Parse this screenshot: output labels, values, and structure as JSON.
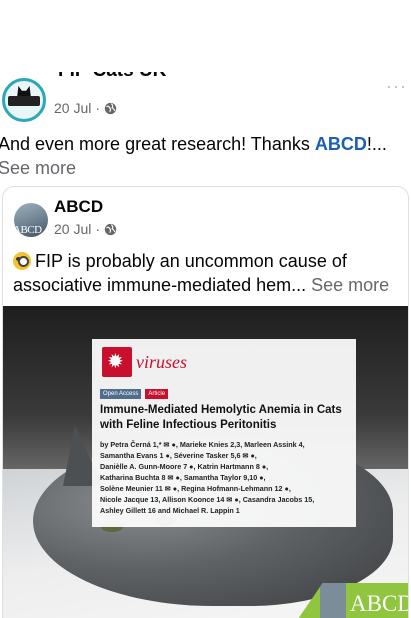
{
  "outer_post": {
    "page_name": "FIP Cats UK",
    "date": "20 Jul",
    "more": "···",
    "text_before": "And even more great research! Thanks ",
    "text_tag": "ABCD",
    "text_after": "!...",
    "see_more": "See more"
  },
  "shared_post": {
    "page_name": "ABCD",
    "avatar_text": "ABCD",
    "date": "20 Jul",
    "text": "FIP is probably an uncommon cause of associative immune-mediated hem...",
    "see_more": "See more"
  },
  "paper": {
    "journal": "viruses",
    "badge_open_access": "Open Access",
    "badge_article": "Article",
    "title": "Immune-Mediated Hemolytic Anemia in Cats with Feline Infectious Peritonitis",
    "authors_line1": "by Petra Černá 1,* ✉ ●, Marieke Knies 2,3, Marleen Assink 4,",
    "authors_line2": "Samantha Evans 1 ●, Séverine Tasker 5,6 ✉ ●,",
    "authors_line3": "Danièlle A. Gunn-Moore 7 ●, Katrin Hartmann 8 ●,",
    "authors_line4": "Katharina Buchta 8 ✉ ●, Samantha Taylor 9,10 ●,",
    "authors_line5": "Solène Meunier 11 ✉ ●, Regina Hofmann-Lehmann 12 ●,",
    "authors_line6": "Nicole Jacque 13, Allison Koonce 14 ✉ ●, Casandra Jacobs 15,",
    "authors_line7": "Ashley Gillett 16 and Michael R. Lappin 1"
  },
  "watermark": {
    "logo_text": "ABCD"
  }
}
